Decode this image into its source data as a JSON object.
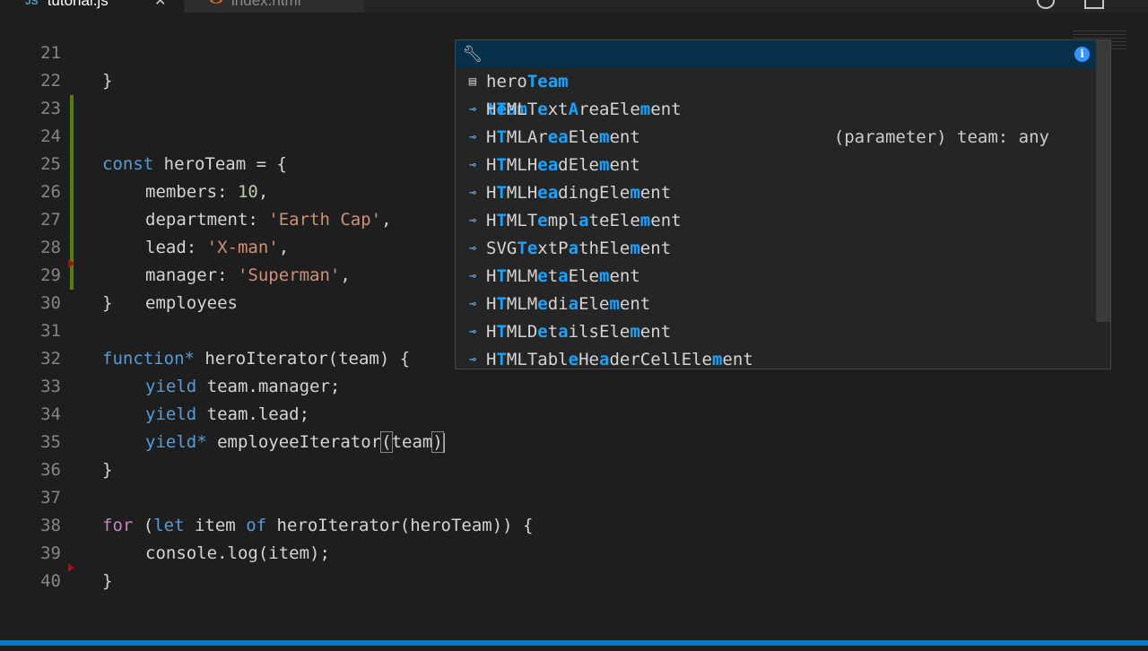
{
  "tabs": [
    {
      "label": "tutorial.js",
      "icon": "js-file-icon",
      "active": true
    },
    {
      "label": "index.html",
      "icon": "html-file-icon",
      "active": false
    }
  ],
  "editor": {
    "line21": {
      "num": "21",
      "text": "}"
    },
    "line22": {
      "num": "22"
    },
    "line23": {
      "num": "23",
      "kw": "const",
      "name": "heroTeam",
      "rest": " = {"
    },
    "line24": {
      "num": "24",
      "key": "members: ",
      "val": "10",
      "tail": ","
    },
    "line25": {
      "num": "25",
      "key": "department: ",
      "val": "'Earth Cap'",
      "tail": ","
    },
    "line26": {
      "num": "26",
      "key": "lead: ",
      "val": "'X-man'",
      "tail": ","
    },
    "line27": {
      "num": "27",
      "key": "manager: ",
      "val": "'Superman'",
      "tail": ","
    },
    "line28": {
      "num": "28",
      "key": "employees"
    },
    "line29": {
      "num": "29",
      "text": "}"
    },
    "line30": {
      "num": "30"
    },
    "line31": {
      "num": "31",
      "kw": "function*",
      "rest": " heroIterator(team) {"
    },
    "line32": {
      "num": "32",
      "kw": "yield",
      "rest": " team.manager;"
    },
    "line33": {
      "num": "33",
      "kw": "yield",
      "rest": " team.lead;"
    },
    "line34": {
      "num": "34",
      "kw": "yield*",
      "a": " employeeIterator",
      "b": "(",
      "c": "team",
      "d": ")"
    },
    "line35": {
      "num": "35",
      "text": "}"
    },
    "line36": {
      "num": "36"
    },
    "line37": {
      "num": "37",
      "kw": "for",
      "p1": " (",
      "kw2": "let",
      "mid": " item ",
      "kw3": "of",
      "rest": " heroIterator(heroTeam)) {"
    },
    "line38": {
      "num": "38",
      "text": "console.log(item);"
    },
    "line39": {
      "num": "39",
      "text": "}"
    },
    "line40": {
      "num": "40"
    }
  },
  "suggest": {
    "selected": {
      "label": "team",
      "detail": "(parameter) team: any",
      "icon": "wrench-icon"
    },
    "items": [
      {
        "label": "heroTeam",
        "icon": "variable-icon"
      },
      {
        "label": "HTMLTextAreaElement",
        "icon": "interface-icon"
      },
      {
        "label": "HTMLAreaElement",
        "icon": "interface-icon"
      },
      {
        "label": "HTMLHeadElement",
        "icon": "interface-icon"
      },
      {
        "label": "HTMLHeadingElement",
        "icon": "interface-icon"
      },
      {
        "label": "HTMLTemplateElement",
        "icon": "interface-icon"
      },
      {
        "label": "SVGTextPathElement",
        "icon": "interface-icon"
      },
      {
        "label": "HTMLMetaElement",
        "icon": "interface-icon"
      },
      {
        "label": "HTMLMediaElement",
        "icon": "interface-icon"
      },
      {
        "label": "HTMLDetailsElement",
        "icon": "interface-icon"
      },
      {
        "label": "HTMLTableHeaderCellElement",
        "icon": "interface-icon"
      }
    ]
  },
  "colors": {
    "background": "#1e1e1e",
    "keyword": "#569cd6",
    "control": "#c586c0",
    "string": "#ce9178",
    "number": "#b5cea8",
    "match": "#18a3ff",
    "statusbar": "#007acc"
  }
}
